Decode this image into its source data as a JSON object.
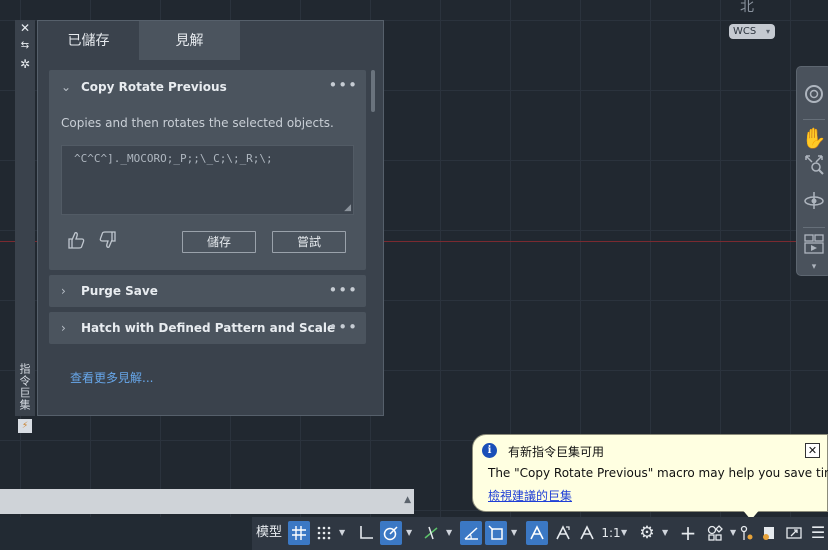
{
  "viewport": {
    "cube_label": "北",
    "wcs_label": "WCS"
  },
  "palette": {
    "strip_title": "指令巨集",
    "tabs": [
      {
        "label": "已儲存",
        "active": false
      },
      {
        "label": "見解",
        "active": true
      }
    ],
    "cards": [
      {
        "title": "Copy Rotate Previous",
        "expanded": true,
        "description": "Copies and then rotates the selected objects.",
        "macro": "^C^C^]._MOCORO;_P;;\\_C;\\;_R;\\;",
        "save_label": "儲存",
        "try_label": "嘗試"
      },
      {
        "title": "Purge Save",
        "expanded": false
      },
      {
        "title": "Hatch with Defined Pattern and Scale",
        "expanded": false
      }
    ],
    "more_link": "查看更多見解..."
  },
  "notification": {
    "title": "有新指令巨集可用",
    "message": "The \"Copy Rotate Previous\" macro may help you save time",
    "link": "檢視建議的巨集"
  },
  "statusbar": {
    "model_label": "模型",
    "scale_label": "1:1",
    "active_buttons": [
      "grid",
      "polar",
      "dynamic-input-angle",
      "selection-cycling",
      "annotation-visibility"
    ]
  },
  "colors": {
    "accent": "#3b78c4",
    "link": "#67a7ea",
    "axis_red": "#7a2a30",
    "notification_bg": "#ffffe1"
  }
}
